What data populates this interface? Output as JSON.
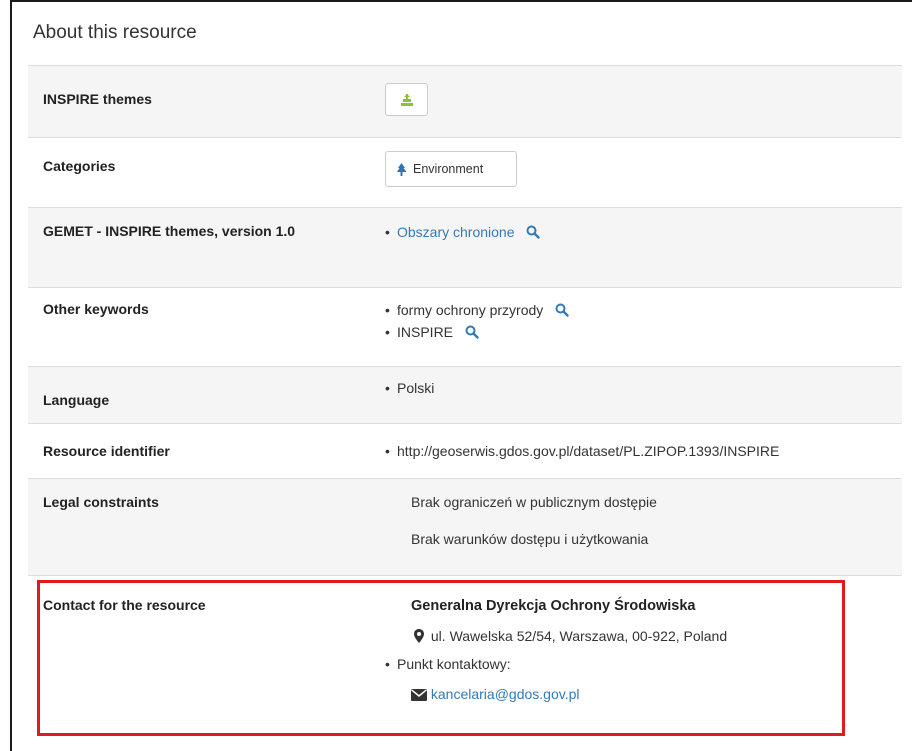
{
  "section_title": "About this resource",
  "rows": {
    "inspire_themes": {
      "label": "INSPIRE themes"
    },
    "categories": {
      "label": "Categories",
      "button": "Environment"
    },
    "gemet": {
      "label": "GEMET - INSPIRE themes, version 1.0",
      "keywords": [
        "Obszary chronione"
      ]
    },
    "other_keywords": {
      "label": "Other keywords",
      "keywords": [
        "formy ochrony przyrody",
        "INSPIRE"
      ]
    },
    "language": {
      "label": "Language",
      "value": "Polski"
    },
    "resource_identifier": {
      "label": "Resource identifier",
      "value": "http://geoserwis.gdos.gov.pl/dataset/PL.ZIPOP.1393/INSPIRE"
    },
    "legal_constraints": {
      "label": "Legal constraints",
      "lines": [
        "Brak ograniczeń w publicznym dostępie",
        "Brak warunków dostępu i użytkowania"
      ]
    },
    "contact": {
      "label": "Contact for the resource",
      "organisation": "Generalna Dyrekcja Ochrony Środowiska",
      "address": "ul. Wawelska 52/54, Warszawa, 00-922, Poland",
      "role": "Punkt kontaktowy:",
      "email": "kancelaria@gdos.gov.pl"
    }
  },
  "colors": {
    "link": "#337ab7",
    "highlight": "#e01b1b",
    "tree": "#2e75b6",
    "theme_icon": "#8dbe3c"
  },
  "icons": [
    "tree-icon",
    "theme-icon",
    "search-icon",
    "map-marker-icon",
    "envelope-icon"
  ]
}
